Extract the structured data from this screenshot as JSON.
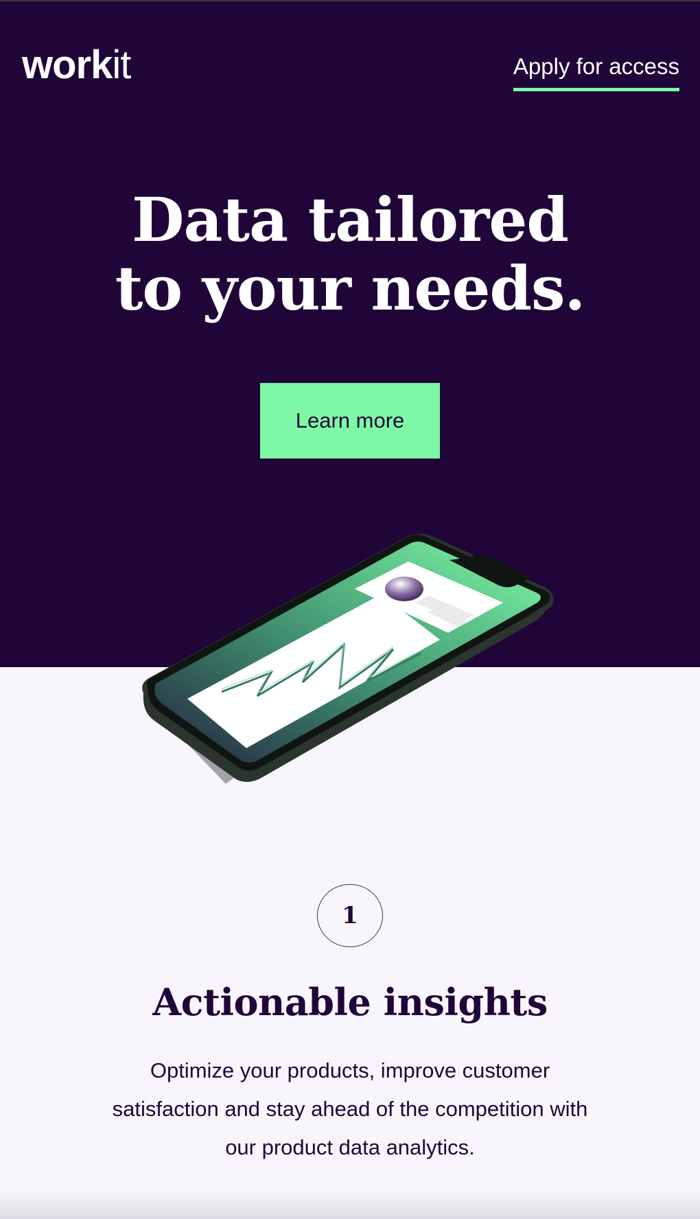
{
  "header": {
    "logo_bold": "work",
    "logo_light": "it",
    "apply_link": "Apply for access"
  },
  "hero": {
    "headline_line1": "Data tailored",
    "headline_word1": "Data ",
    "headline_accent": "tailored",
    "headline_line2": "to your needs.",
    "cta_label": "Learn more"
  },
  "feature": {
    "step_number": "1",
    "title": "Actionable insights",
    "description": "Optimize your products, improve customer satisfaction and stay ahead of the competition with our product data analytics."
  },
  "colors": {
    "hero_bg": "#200638",
    "accent_green": "#7DF9A6",
    "page_bg": "#F8F6FC"
  }
}
